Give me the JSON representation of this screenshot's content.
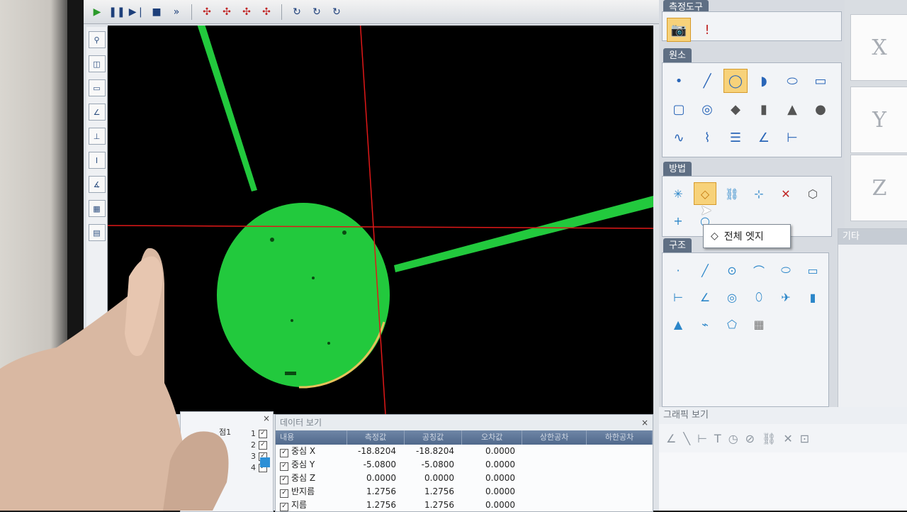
{
  "right_panel": {
    "measure_tools_title": "측정도구",
    "elements_title": "원소",
    "method_title": "방법",
    "structure_title": "구조",
    "etc_title": "기타",
    "graphic_view_title": "그래픽 보기",
    "tooltip": "전체 엣지"
  },
  "axes": {
    "x": "X",
    "y": "Y",
    "z": "Z"
  },
  "feature_list": {
    "item": "점1",
    "row_numbers": [
      "1",
      "2",
      "3",
      "4"
    ]
  },
  "data_view": {
    "title": "데이터 보기",
    "columns": [
      "내용",
      "측정값",
      "공칭값",
      "오차값",
      "상한공차",
      "하한공차"
    ],
    "rows": [
      {
        "name": "중심 X",
        "measured": "-18.8204",
        "nominal": "-18.8204",
        "error": "0.0000"
      },
      {
        "name": "중심 Y",
        "measured": "-5.0800",
        "nominal": "-5.0800",
        "error": "0.0000"
      },
      {
        "name": "중심 Z",
        "measured": "0.0000",
        "nominal": "0.0000",
        "error": "0.0000"
      },
      {
        "name": "반지름",
        "measured": "1.2756",
        "nominal": "1.2756",
        "error": "0.0000"
      },
      {
        "name": "지름",
        "measured": "1.2756",
        "nominal": "1.2756",
        "error": "0.0000"
      }
    ]
  },
  "colors": {
    "feature_green": "#22c93d",
    "crosshair_red": "#e01818",
    "highlight": "#f7d27a"
  }
}
